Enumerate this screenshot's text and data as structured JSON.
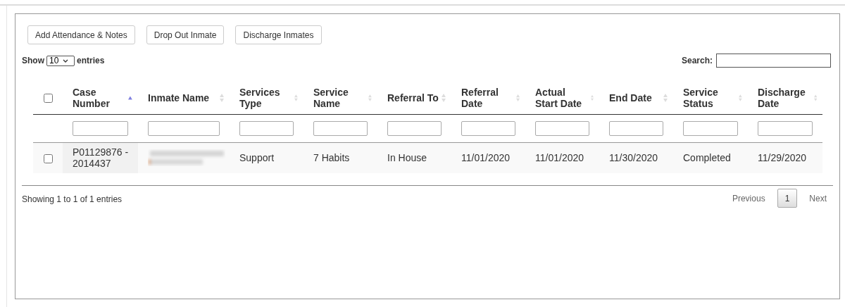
{
  "toolbar": {
    "buttons": [
      "Add Attendance & Notes",
      "Drop Out Inmate",
      "Discharge Inmates"
    ]
  },
  "length_menu": {
    "label_before": "Show",
    "value": "10",
    "label_after": "entries"
  },
  "search": {
    "label": "Search:"
  },
  "table": {
    "select_all_checked": false,
    "columns": [
      {
        "label": "Case Number",
        "sorted": true
      },
      {
        "label": "Inmate Name",
        "sorted": false
      },
      {
        "label": "Services Type",
        "sorted": false
      },
      {
        "label": "Service Name",
        "sorted": false
      },
      {
        "label": "Referral To",
        "sorted": false
      },
      {
        "label": "Referral Date",
        "sorted": false
      },
      {
        "label": "Actual Start Date",
        "sorted": false
      },
      {
        "label": "End Date",
        "sorted": false
      },
      {
        "label": "Service Status",
        "sorted": false
      },
      {
        "label": "Discharge Date",
        "sorted": false
      }
    ],
    "rows": [
      {
        "checked": false,
        "cells": [
          {
            "kind": "text",
            "text": "P01129876 - 2014437"
          },
          {
            "kind": "redacted"
          },
          {
            "kind": "text",
            "text": "Support"
          },
          {
            "kind": "text",
            "text": "7 Habits"
          },
          {
            "kind": "text",
            "text": "In House"
          },
          {
            "kind": "text",
            "text": "11/01/2020"
          },
          {
            "kind": "text",
            "text": "11/01/2020"
          },
          {
            "kind": "text",
            "text": "11/30/2020"
          },
          {
            "kind": "text",
            "text": "Completed"
          },
          {
            "kind": "text",
            "text": "11/29/2020"
          }
        ]
      }
    ]
  },
  "info": "Showing 1 to 1 of 1 entries",
  "pagination": [
    {
      "label": "Previous",
      "kind": "prev",
      "disabled": true,
      "selected": false
    },
    {
      "label": "1",
      "kind": "page",
      "disabled": false,
      "selected": true
    },
    {
      "label": "Next",
      "kind": "next",
      "disabled": true,
      "selected": false
    }
  ]
}
